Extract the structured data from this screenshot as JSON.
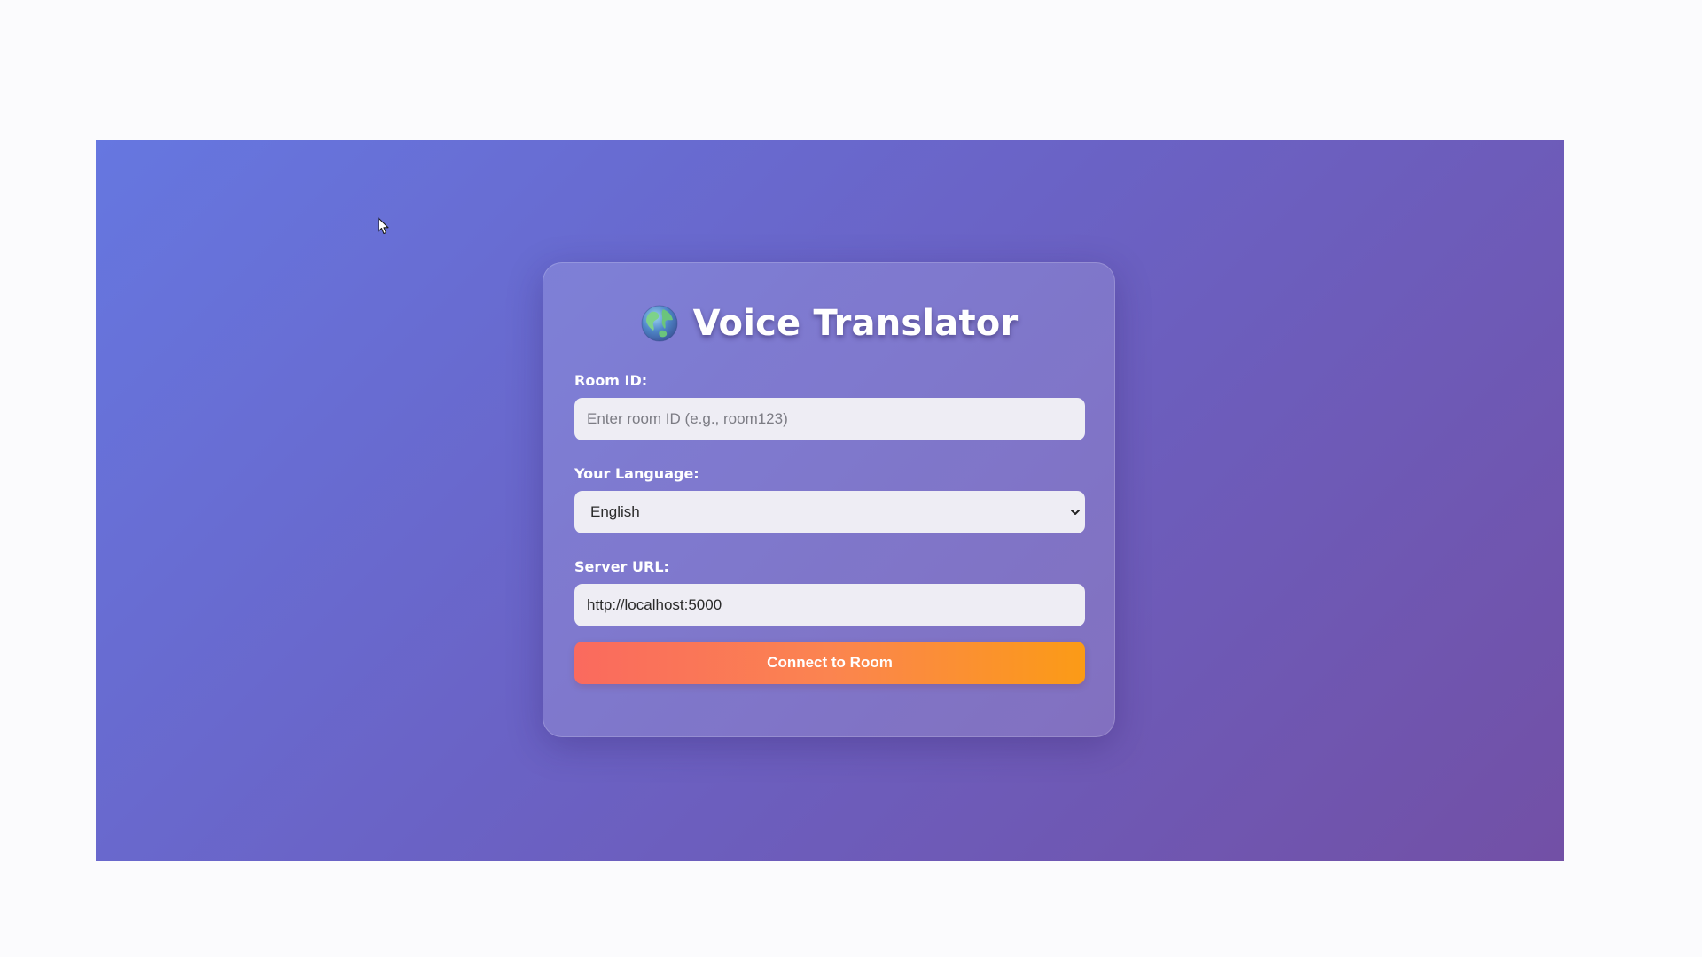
{
  "app": {
    "title": "Voice Translator",
    "title_icon": "globe-icon"
  },
  "form": {
    "room_id": {
      "label": "Room ID:",
      "value": "",
      "placeholder": "Enter room ID (e.g., room123)"
    },
    "language": {
      "label": "Your Language:",
      "selected": "English"
    },
    "server_url": {
      "label": "Server URL:",
      "value": "http://localhost:5000"
    },
    "connect_label": "Connect to Room"
  },
  "colors": {
    "background_start": "#6677e0",
    "background_end": "#7250a6",
    "button_start": "#fa6a5e",
    "button_end": "#fb9b16"
  }
}
